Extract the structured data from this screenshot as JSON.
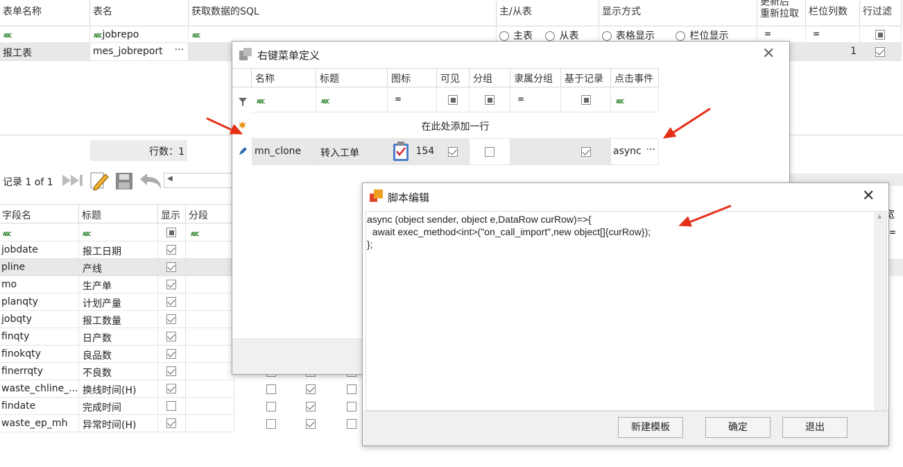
{
  "top_grid": {
    "headers": [
      "表单名称",
      "表名",
      "获取数据的SQL",
      "主/从表",
      "显示方式",
      "更新后",
      "重新拉取",
      "栏位列数",
      "行过滤"
    ],
    "row": {
      "name": "报工表",
      "table": "mes_jobreport",
      "cols": "1"
    },
    "filter_table": "jobrepo",
    "radio_master": "主表",
    "radio_slave": "从表",
    "radio_grid": "表格显示",
    "radio_field": "栏位显示"
  },
  "row_count_label": "行数：1",
  "nav": {
    "record": "记录 1 of 1"
  },
  "field_grid": {
    "headers": [
      "字段名",
      "标题",
      "显示",
      "分段"
    ],
    "rows": [
      {
        "name": "jobdate",
        "title": "报工日期",
        "show": true
      },
      {
        "name": "pline",
        "title": "产线",
        "show": true
      },
      {
        "name": "mo",
        "title": "生产单",
        "show": true
      },
      {
        "name": "planqty",
        "title": "计划产量",
        "show": true
      },
      {
        "name": "jobqty",
        "title": "报工数量",
        "show": true
      },
      {
        "name": "finqty",
        "title": "日产数",
        "show": true
      },
      {
        "name": "finokqty",
        "title": "良品数",
        "show": true
      },
      {
        "name": "finerrqty",
        "title": "不良数",
        "show": true
      },
      {
        "name": "waste_chline_...",
        "title": "换线时间(H)",
        "show": true
      },
      {
        "name": "findate",
        "title": "完成时间",
        "show": false
      },
      {
        "name": "waste_ep_mh",
        "title": "异常时间(H)",
        "show": true
      }
    ],
    "partial_width_header": "宽度"
  },
  "menu_dialog": {
    "title": "右键菜单定义",
    "headers": [
      "名称",
      "标题",
      "图标",
      "可见",
      "分组",
      "隶属分组",
      "基于记录",
      "点击事件"
    ],
    "add_row": "在此处添加一行",
    "row": {
      "name": "mn_clone",
      "title": "转入工单",
      "icon_no": "154",
      "event": "async"
    }
  },
  "script_dialog": {
    "title": "脚本编辑",
    "code": "async (object sender, object e,DataRow curRow)=>{\n  await exec_method<int>(\"on_call_import\",new object[]{curRow});\n};",
    "buttons": {
      "new_template": "新建模板",
      "ok": "确定",
      "exit": "退出"
    }
  },
  "icons": [
    "abc-filter-icon",
    "funnel-icon",
    "pencil-icon",
    "clipboard-icon",
    "last-record-icon",
    "edit-doc-icon",
    "save-icon",
    "undo-icon",
    "close-icon",
    "window-icon"
  ],
  "colors": {
    "accent_red": "#e53018",
    "selected_row": "#e8e8e8"
  }
}
